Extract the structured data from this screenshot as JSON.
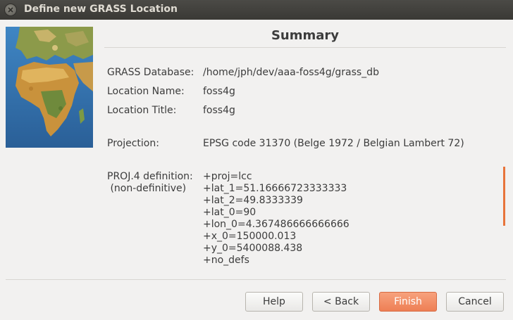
{
  "window": {
    "title": "Define new GRASS Location"
  },
  "summary": {
    "heading": "Summary",
    "database_label": "GRASS Database:",
    "database_value": "/home/jph/dev/aaa-foss4g/grass_db",
    "location_name_label": "Location Name:",
    "location_name_value": "foss4g",
    "location_title_label": "Location Title:",
    "location_title_value": "foss4g",
    "projection_label": "Projection:",
    "projection_value": "EPSG code 31370 (Belge 1972 / Belgian Lambert 72)",
    "proj4_label_line1": "PROJ.4 definition:",
    "proj4_label_line2": " (non-definitive)",
    "proj4_lines": [
      "+proj=lcc",
      "+lat_1=51.16666723333333",
      "+lat_2=49.8333339",
      "+lat_0=90",
      "+lon_0=4.367486666666666",
      "+x_0=150000.013",
      "+y_0=5400088.438",
      "+no_defs"
    ]
  },
  "buttons": {
    "help": "Help",
    "back": "< Back",
    "finish": "Finish",
    "cancel": "Cancel"
  },
  "colors": {
    "titlebar": "#3d3c38",
    "accent": "#ee7f55",
    "scroll_indicator": "#e8743b"
  },
  "icons": {
    "close": "close-icon",
    "image": "world-map-image"
  }
}
